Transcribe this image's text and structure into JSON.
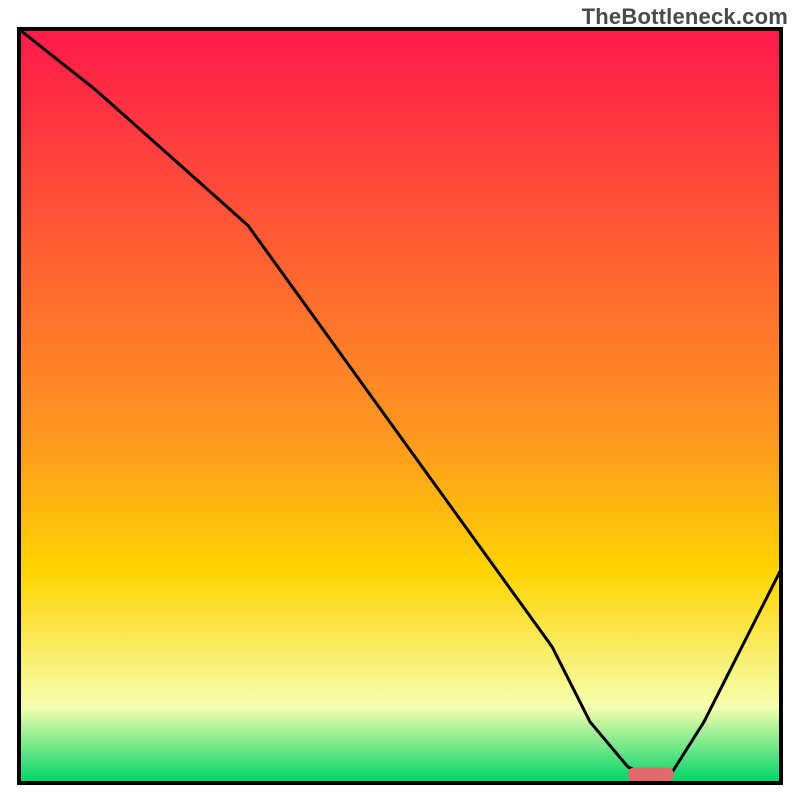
{
  "watermark": "TheBottleneck.com",
  "chart_data": {
    "type": "line",
    "title": "",
    "xlabel": "",
    "ylabel": "",
    "xlim": [
      0,
      100
    ],
    "ylim": [
      0,
      100
    ],
    "grid": false,
    "colors": {
      "top": "#ff1a4a",
      "mid": "#ffd400",
      "bottom": "#00d46a",
      "curve": "#000000",
      "marker": "#e36a6a",
      "frame": "#000000"
    },
    "series": [
      {
        "name": "bottleneck-curve",
        "x": [
          0,
          10,
          20,
          30,
          40,
          50,
          60,
          70,
          75,
          80,
          85,
          90,
          100
        ],
        "values": [
          100,
          92,
          83,
          74,
          60,
          46,
          32,
          18,
          8,
          2,
          0,
          8,
          28
        ]
      }
    ],
    "marker": {
      "x_start": 80,
      "x_end": 86,
      "y": 1
    }
  }
}
